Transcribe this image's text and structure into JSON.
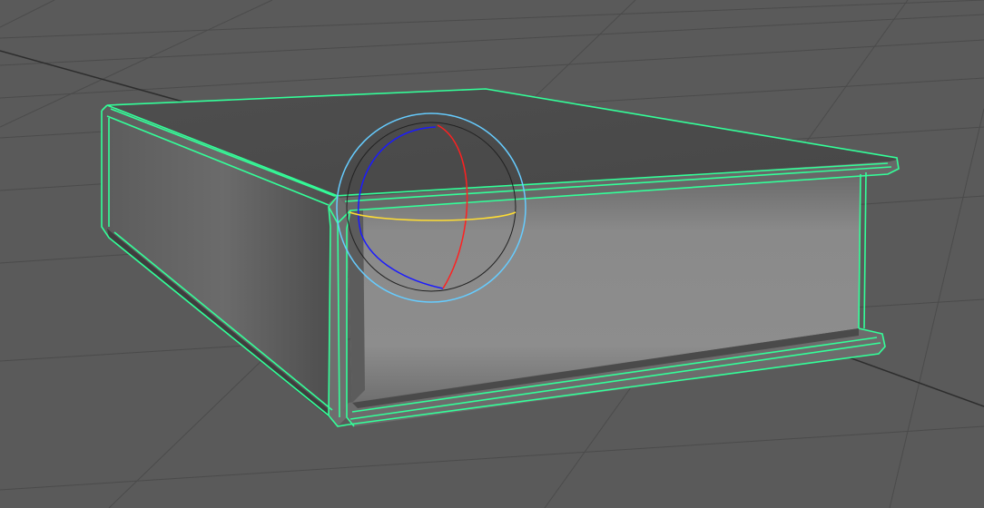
{
  "viewport": {
    "background_color": "#5a5a5a",
    "grid_color": "#4b4b4b",
    "axis_line_color": "#2d2d2d",
    "object": {
      "name": "book",
      "selected": true,
      "wireframe_color": "#33ff99"
    },
    "manipulator": {
      "type": "rotate",
      "outer_ring_color": "#66ccff",
      "x_axis_color": "#ff2020",
      "y_axis_color": "#ffdd33",
      "z_axis_color": "#1a1aff",
      "trackball_color": "#222222"
    }
  }
}
